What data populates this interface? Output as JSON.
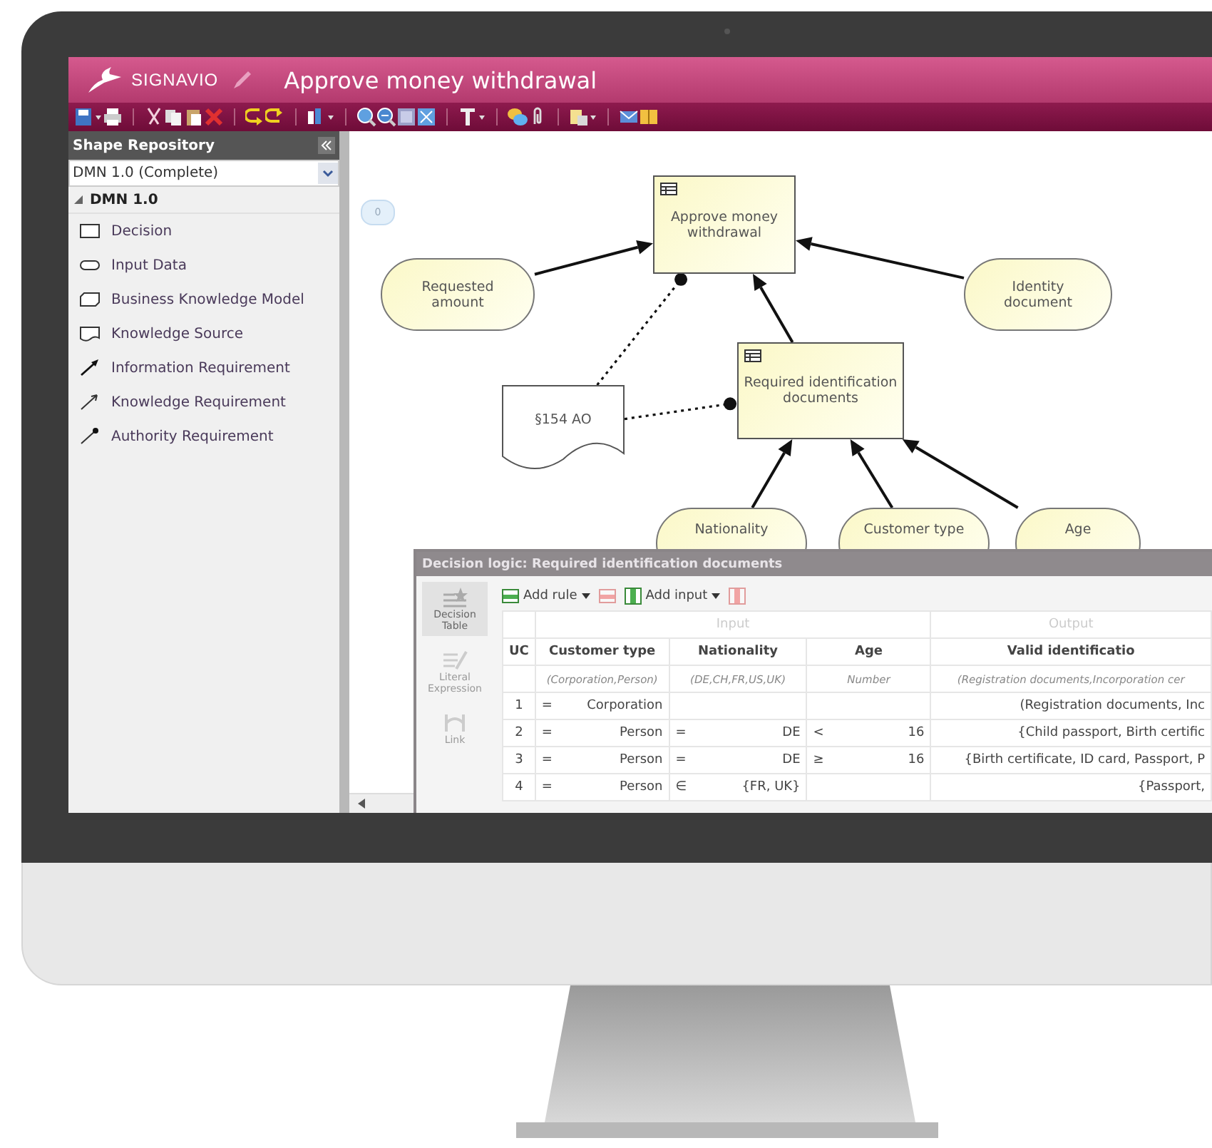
{
  "header": {
    "brand": "SIGNAVIO",
    "document_title": "Approve money withdrawal"
  },
  "sidebar": {
    "title": "Shape Repository",
    "dropdown_value": "DMN 1.0 (Complete)",
    "group": {
      "label": "DMN 1.0",
      "expanded": true,
      "items": [
        {
          "label": "Decision",
          "kind": "decision"
        },
        {
          "label": "Input Data",
          "kind": "input-data"
        },
        {
          "label": "Business Knowledge Model",
          "kind": "bkm"
        },
        {
          "label": "Knowledge Source",
          "kind": "knowledge-source"
        },
        {
          "label": "Information Requirement",
          "kind": "information"
        },
        {
          "label": "Knowledge Requirement",
          "kind": "knowledge"
        },
        {
          "label": "Authority Requirement",
          "kind": "authority"
        }
      ]
    }
  },
  "canvas": {
    "comment_count": "0",
    "nodes": [
      {
        "label": "Approve money withdrawal",
        "kind": "decision"
      },
      {
        "label": "Requested amount",
        "kind": "input"
      },
      {
        "label": "Identity document",
        "kind": "input"
      },
      {
        "label": "Required identification documents",
        "kind": "decision"
      },
      {
        "label": "§154 AO",
        "kind": "knowledge-source"
      },
      {
        "label": "Nationality",
        "kind": "input"
      },
      {
        "label": "Customer type",
        "kind": "input"
      },
      {
        "label": "Age",
        "kind": "input"
      }
    ],
    "edges": [
      {
        "kind": "information"
      },
      {
        "kind": "information"
      },
      {
        "kind": "information"
      },
      {
        "kind": "authority"
      },
      {
        "kind": "authority"
      },
      {
        "kind": "information"
      },
      {
        "kind": "information"
      },
      {
        "kind": "information"
      }
    ]
  },
  "dialog": {
    "title": "Decision logic: Required identification documents",
    "nav": [
      {
        "label": "Decision Table",
        "selected": true,
        "disabled": false
      },
      {
        "label": "Literal Expression",
        "selected": false,
        "disabled": true
      },
      {
        "label": "Link",
        "selected": false,
        "disabled": true
      }
    ],
    "toolbar": [
      {
        "kind": "add-rule",
        "label": "Add rule",
        "disabled": false
      },
      {
        "kind": "remove-rule",
        "disabled": true
      },
      {
        "kind": "add-input",
        "label": "Add input",
        "disabled": false
      },
      {
        "kind": "remove-input",
        "disabled": true
      }
    ],
    "table": {
      "input_header": "Input",
      "output_header": "Output",
      "columns": [
        "UC",
        "Customer type",
        "Nationality",
        "Age",
        "Valid identificatio"
      ],
      "types": [
        "(Corporation,Person)",
        "(DE,CH,FR,US,UK)",
        "Number",
        "(Registration documents,Incorporation cer"
      ],
      "rows": [
        {
          "cells": [
            "1",
            {
              "op": "=",
              "value": "Corporation"
            },
            null,
            null,
            "(Registration documents, Inc"
          ]
        },
        {
          "cells": [
            "2",
            {
              "op": "=",
              "value": "Person"
            },
            {
              "op": "=",
              "value": "DE"
            },
            {
              "op": "<",
              "value": "16"
            },
            "{Child passport, Birth certific"
          ]
        },
        {
          "cells": [
            "3",
            {
              "op": "=",
              "value": "Person"
            },
            {
              "op": "=",
              "value": "DE"
            },
            {
              "op": "≥",
              "value": "16"
            },
            "{Birth certificate, ID card, Passport, P"
          ]
        },
        {
          "cells": [
            "4",
            {
              "op": "=",
              "value": "Person"
            },
            {
              "op": "∈",
              "value": "{FR, UK}"
            },
            null,
            "{Passport,"
          ]
        }
      ]
    }
  }
}
